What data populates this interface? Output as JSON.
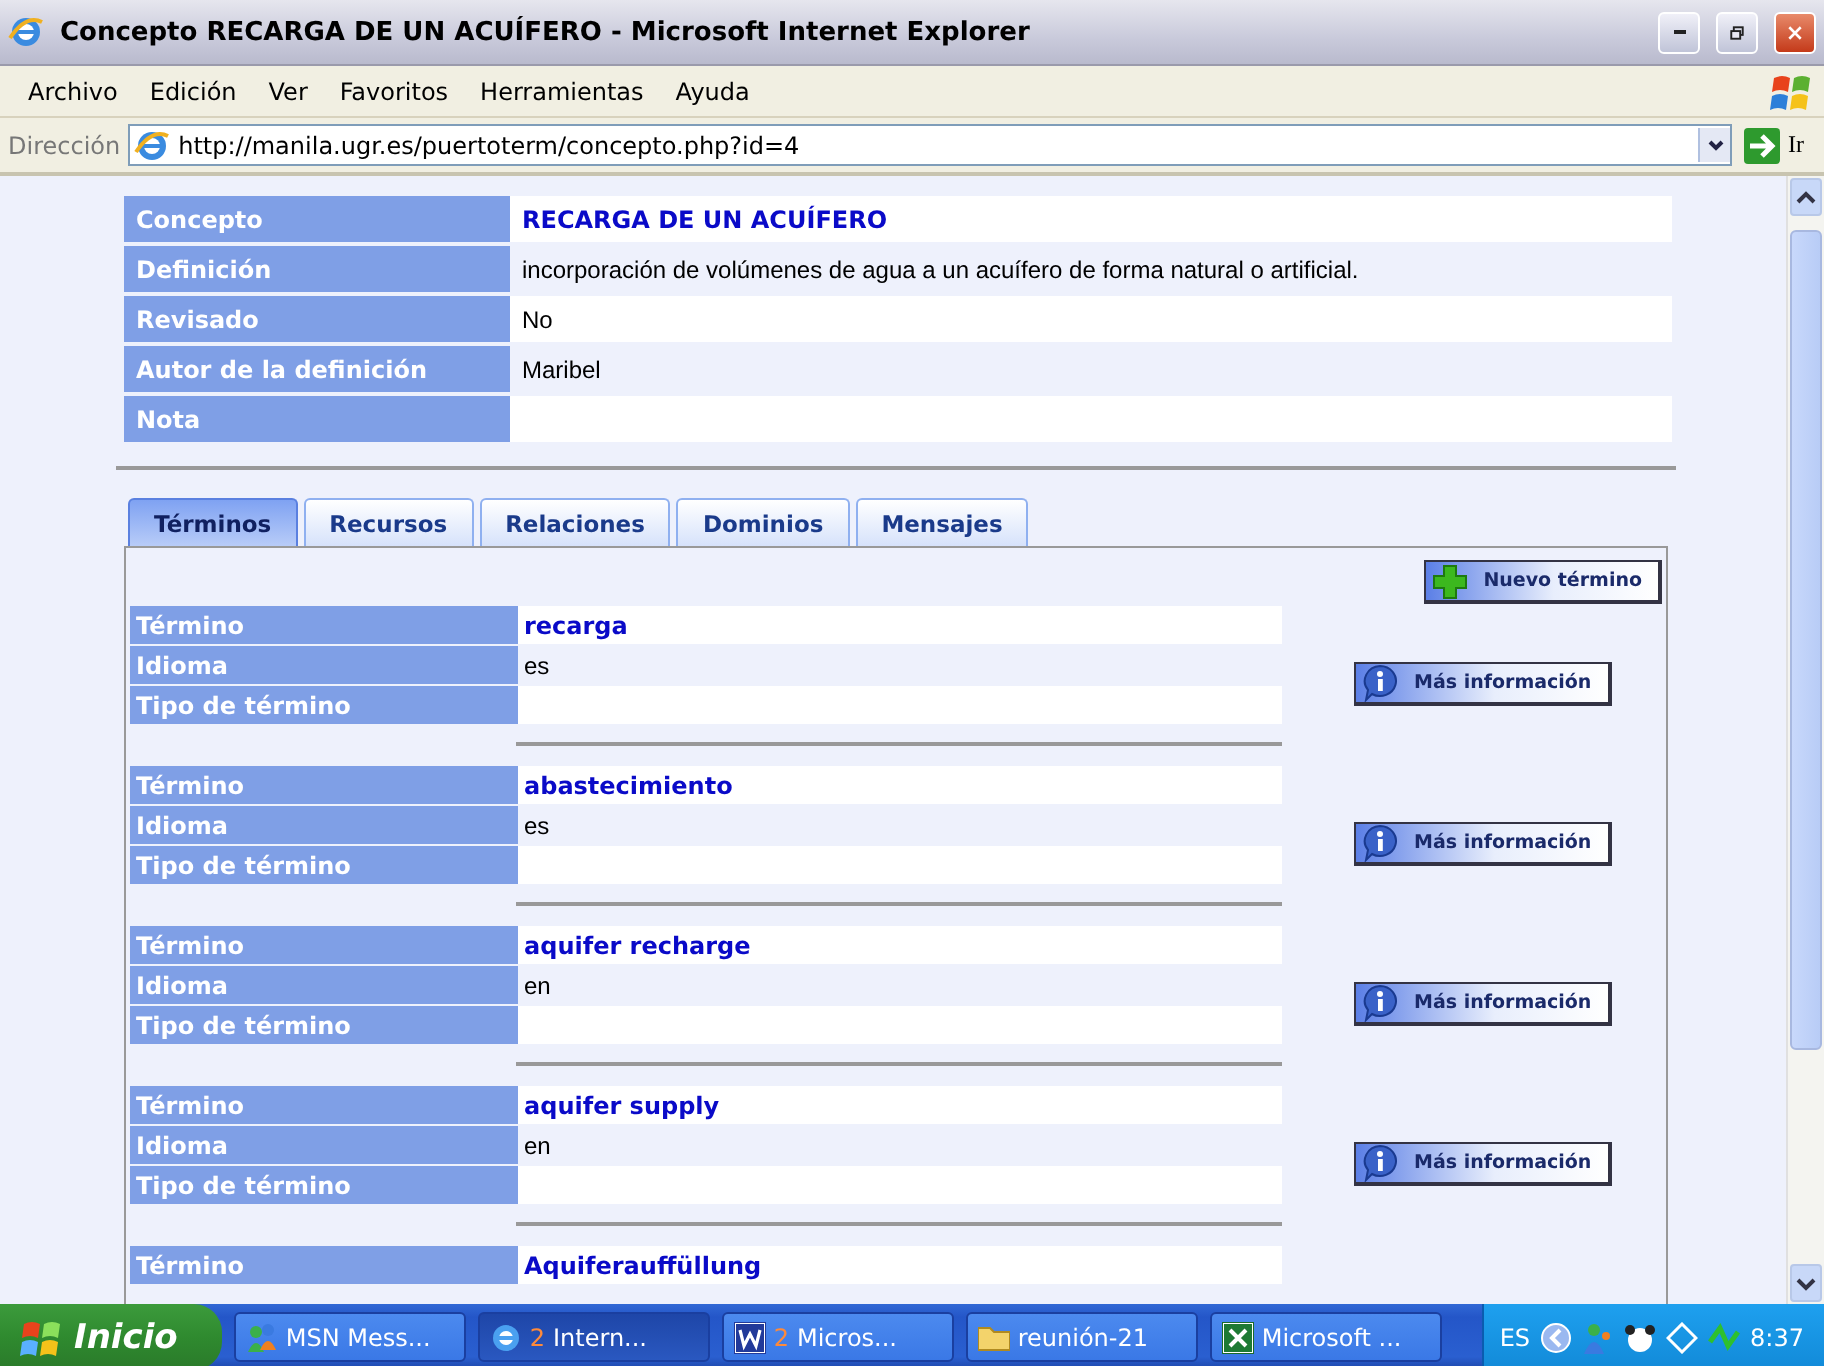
{
  "window": {
    "title": "Concepto RECARGA DE UN ACUÍFERO - Microsoft Internet Explorer"
  },
  "menu": [
    "Archivo",
    "Edición",
    "Ver",
    "Favoritos",
    "Herramientas",
    "Ayuda"
  ],
  "address": {
    "label": "Dirección",
    "value": "http://manila.ugr.es/puertoterm/concepto.php?id=4",
    "go": "Ir"
  },
  "concept": [
    {
      "label": "Concepto",
      "value": "RECARGA DE UN ACUÍFERO",
      "kind": "title"
    },
    {
      "label": "Definición",
      "value": "incorporación de volúmenes de agua a un acuífero de forma natural o artificial.",
      "kind": "text"
    },
    {
      "label": "Revisado",
      "value": "No",
      "kind": "text"
    },
    {
      "label": "Autor de la definición",
      "value": "Maribel",
      "kind": "text"
    },
    {
      "label": "Nota",
      "kind": "text"
    }
  ],
  "tabs": [
    {
      "label": "Términos",
      "selected": true
    },
    {
      "label": "Recursos",
      "selected": false
    },
    {
      "label": "Relaciones",
      "selected": false
    },
    {
      "label": "Dominios",
      "selected": false
    },
    {
      "label": "Mensajes",
      "selected": false
    }
  ],
  "new_term_button": "Nuevo término",
  "terms": [
    {
      "fields": [
        {
          "label": "Término",
          "value": "recarga"
        },
        {
          "label": "Idioma",
          "value": "es"
        },
        {
          "label": "Tipo de término"
        }
      ],
      "button": "Más información"
    },
    {
      "fields": [
        {
          "label": "Término",
          "value": "abastecimiento"
        },
        {
          "label": "Idioma",
          "value": "es"
        },
        {
          "label": "Tipo de término"
        }
      ],
      "button": "Más información"
    },
    {
      "fields": [
        {
          "label": "Término",
          "value": "aquifer recharge"
        },
        {
          "label": "Idioma",
          "value": "en"
        },
        {
          "label": "Tipo de término"
        }
      ],
      "button": "Más información"
    },
    {
      "fields": [
        {
          "label": "Término",
          "value": "aquifer supply"
        },
        {
          "label": "Idioma",
          "value": "en"
        },
        {
          "label": "Tipo de término"
        }
      ],
      "button": "Más información"
    },
    {
      "fields": [
        {
          "label": "Término",
          "value": "Aquiferauffüllung"
        }
      ]
    }
  ],
  "taskbar": {
    "start": "Inicio",
    "items": [
      {
        "label": "MSN Mess...",
        "selected": false,
        "kind": "msn"
      },
      {
        "label": "Intern...",
        "count": "2",
        "selected": true,
        "kind": "ie"
      },
      {
        "label": "Micros...",
        "count": "2",
        "selected": false,
        "kind": "word"
      },
      {
        "label": "reunión-21",
        "selected": false,
        "kind": "folder"
      },
      {
        "label": "Microsoft ...",
        "selected": false,
        "kind": "excel"
      }
    ],
    "language": "ES",
    "clock": "8:37"
  }
}
